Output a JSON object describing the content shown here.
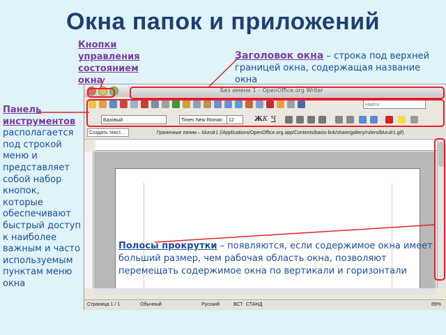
{
  "slide": {
    "title": "Окна папок и приложений",
    "notes": {
      "controls": "Кнопки управления состоянием окна",
      "window_title_head": "Заголовок окна",
      "window_title_text": " – строка под верхней границей окна, содержащая название окна",
      "toolbar_head": "Панель инструментов",
      "toolbar_text": " располагается под строкой меню и представляет собой набор кнопок, которые обеспечивают быстрый доступ к наиболее важным и часто используемым пунктам меню окна",
      "scroll_head": "Полосы прокрутки",
      "scroll_text": " – появляются, если содержимое окна имеет больший размер, чем рабочая область окна, позволяют перемещать содержимое окна по вертикали и горизонтали"
    }
  },
  "app": {
    "window_title": "Без имени 1 – OpenOffice.org Writer",
    "style": "Базовый",
    "font": "Times New Roman",
    "size": "12",
    "find_placeholder": "Найти",
    "toolbar3_text": "Создать текст...",
    "toolbar3_path": "Граничные линии – blurulr1 (/Applications/OpenOffice.org.app/Contents/basis-link/share/gallery/rulers/blurulr1.gif)",
    "status": {
      "page": "Страница 1 / 1",
      "style": "Обычный",
      "lang": "Русский",
      "ins": "ВСТ",
      "std": "СТАНД",
      "zoom": "89%"
    }
  },
  "colors": {
    "highlight": "#e0202c",
    "note_purple": "#7a3e9e",
    "note_blue": "#1c4e9a"
  }
}
